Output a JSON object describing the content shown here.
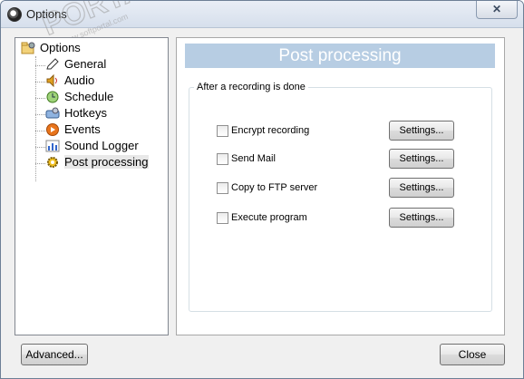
{
  "window": {
    "title": "Options",
    "close_glyph": "✕"
  },
  "tree": {
    "root": {
      "label": "Options",
      "icon": "folder-gear-icon"
    },
    "items": [
      {
        "label": "General",
        "icon": "pencil-icon"
      },
      {
        "label": "Audio",
        "icon": "speaker-icon"
      },
      {
        "label": "Schedule",
        "icon": "clock-icon"
      },
      {
        "label": "Hotkeys",
        "icon": "keyboard-icon"
      },
      {
        "label": "Events",
        "icon": "play-icon"
      },
      {
        "label": "Sound Logger",
        "icon": "bar-chart-icon"
      },
      {
        "label": "Post processing",
        "icon": "gear-icon",
        "selected": true
      }
    ]
  },
  "panel": {
    "header": "Post processing",
    "group_label": "After a recording is done",
    "options": [
      {
        "label": "Encrypt recording",
        "checked": false,
        "button": "Settings..."
      },
      {
        "label": "Send Mail",
        "checked": false,
        "button": "Settings..."
      },
      {
        "label": "Copy to FTP server",
        "checked": false,
        "button": "Settings..."
      },
      {
        "label": "Execute program",
        "checked": false,
        "button": "Settings..."
      }
    ]
  },
  "buttons": {
    "advanced": "Advanced...",
    "close": "Close"
  },
  "watermark": {
    "text": "PORTAL",
    "sub": "www.softportal.com",
    "mark": "™"
  },
  "colors": {
    "header_bg": "#b7cde3",
    "selection_bg": "#e8e8e8"
  }
}
